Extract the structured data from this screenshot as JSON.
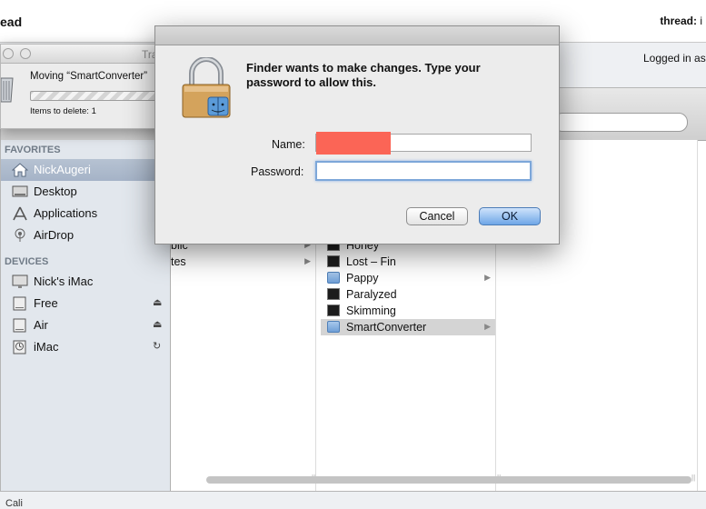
{
  "web": {
    "title_fragment": "ead",
    "thread_label": "thread:",
    "thread_suffix": "i",
    "logged_in": "Logged in as",
    "bottom_text": "Cali"
  },
  "progress_window": {
    "title_fragment": "Tra",
    "moving_text": "Moving “SmartConverter”",
    "items_to_delete": "Items to delete: 1"
  },
  "sidebar": {
    "favorites_header": "FAVORITES",
    "favorites": [
      {
        "label": "NickAugeri",
        "icon": "home-icon",
        "selected": true
      },
      {
        "label": "Desktop",
        "icon": "desktop-icon"
      },
      {
        "label": "Applications",
        "icon": "applications-icon"
      },
      {
        "label": "AirDrop",
        "icon": "airdrop-icon"
      }
    ],
    "devices_header": "DEVICES",
    "devices": [
      {
        "label": "Nick's iMac",
        "icon": "imac-icon"
      },
      {
        "label": "Free",
        "icon": "disk-icon",
        "action": "⏏"
      },
      {
        "label": "Air",
        "icon": "disk-icon",
        "action": "⏏"
      },
      {
        "label": "iMac",
        "icon": "timemachine-icon",
        "action": "↻"
      }
    ]
  },
  "column1": [
    {
      "label": "blic",
      "arrow": "▶"
    },
    {
      "label": "tes",
      "arrow": "▶"
    }
  ],
  "column2": [
    {
      "label": "Honey",
      "icon": "dark"
    },
    {
      "label": "Lost – Fin",
      "icon": "dark"
    },
    {
      "label": "Pappy",
      "icon": "folder",
      "arrow": "▶"
    },
    {
      "label": "Paralyzed",
      "icon": "dark"
    },
    {
      "label": "Skimming",
      "icon": "dark"
    },
    {
      "label": "SmartConverter",
      "icon": "folder",
      "arrow": "▶",
      "selected": true
    }
  ],
  "dialog": {
    "message": "Finder wants to make changes. Type your password to allow this.",
    "name_label": "Name:",
    "name_value": "",
    "password_label": "Password:",
    "password_value": "",
    "cancel_label": "Cancel",
    "ok_label": "OK"
  },
  "colors": {
    "redaction": "#fb6556",
    "ok_button": "#6ea6e7",
    "selection": "#a5b3c7"
  }
}
